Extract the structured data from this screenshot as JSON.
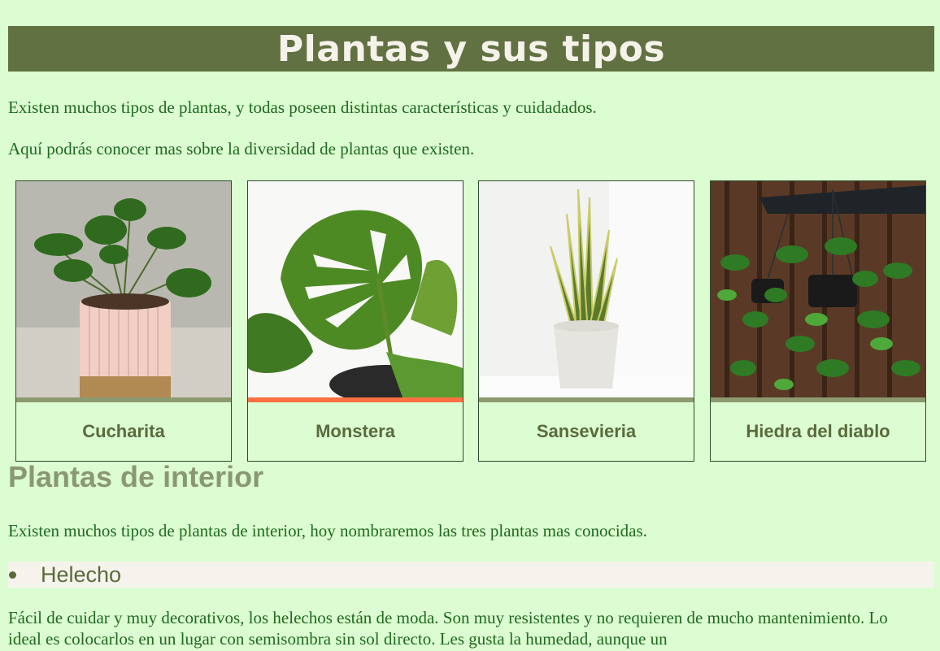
{
  "page": {
    "title": "Plantas y sus tipos",
    "intro_1": "Existen muchos tipos de plantas, y todas poseen distintas características y cuidadados.",
    "intro_2": "Aquí podrás conocer mas sobre la diversidad de plantas que existen."
  },
  "cards": [
    {
      "name": "Cucharita",
      "active": false
    },
    {
      "name": "Monstera",
      "active": true
    },
    {
      "name": "Sansevieria",
      "active": false
    },
    {
      "name": "Hiedra del diablo",
      "active": false
    }
  ],
  "section": {
    "title": "Plantas de interior",
    "intro": "Existen muchos tipos de plantas de interior, hoy nombraremos las tres plantas mas conocidas.",
    "item_label": "Helecho",
    "item_text": "Fácil de cuidar y muy decorativos, los helechos están de moda. Son muy resistentes y no requieren de mucho mantenimiento. Lo ideal es colocarlos en un lugar con semisombra sin sol directo. Les gusta la humedad, aunque un"
  },
  "colors": {
    "background": "#dcfcd2",
    "banner": "#627142",
    "card_bar": "#8c9a70",
    "card_bar_active": "#ff7043"
  }
}
